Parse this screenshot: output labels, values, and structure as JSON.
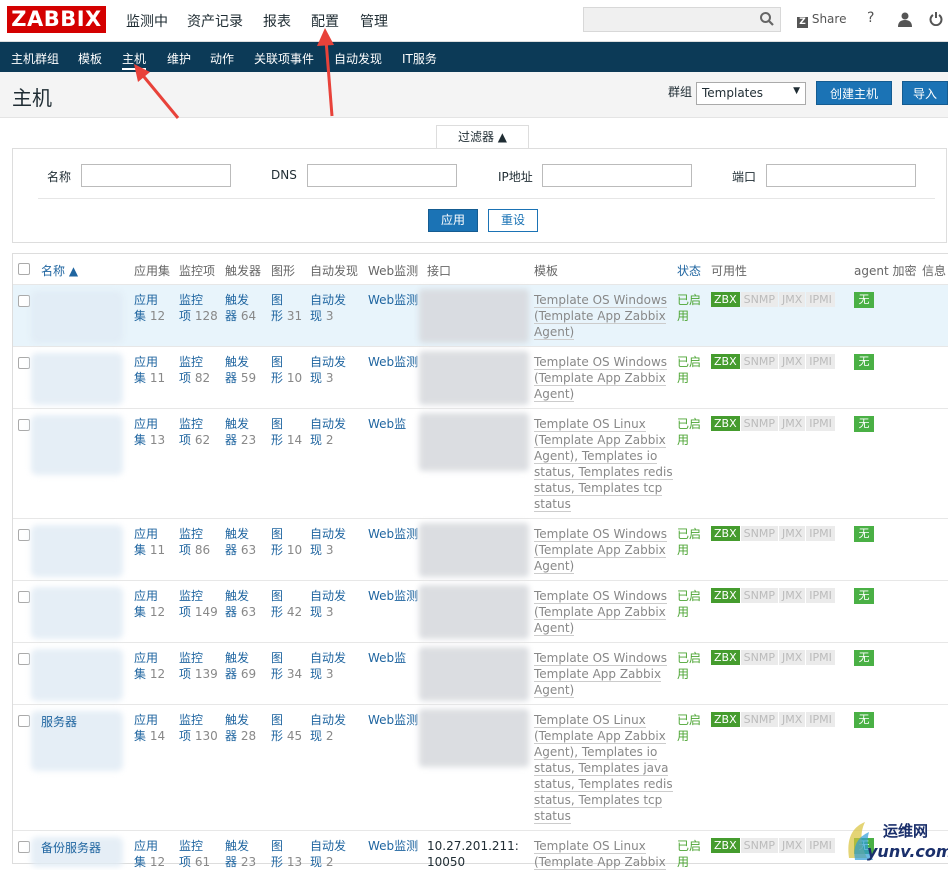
{
  "app": {
    "logo": "ZABBIX"
  },
  "topmenu": [
    "监测中",
    "资产记录",
    "报表",
    "配置",
    "管理"
  ],
  "toptools": {
    "share": "Share",
    "help": "?"
  },
  "navbar": [
    "主机群组",
    "模板",
    "主机",
    "维护",
    "动作",
    "关联项事件",
    "自动发现",
    "IT服务"
  ],
  "header": {
    "title": "主机",
    "group_label": "群组",
    "group_value": "Templates",
    "create_button": "创建主机",
    "import_button": "导入"
  },
  "filter": {
    "tab_label": "过滤器 ▲",
    "fields": [
      {
        "label": "名称",
        "value": ""
      },
      {
        "label": "DNS",
        "value": ""
      },
      {
        "label": "IP地址",
        "value": ""
      },
      {
        "label": "端口",
        "value": ""
      }
    ],
    "apply_button": "应用",
    "reset_button": "重设"
  },
  "table": {
    "columns": [
      "名称 ▲",
      "应用集",
      "监控项",
      "触发器",
      "图形",
      "自动发现",
      "Web监测",
      "接口",
      "模板",
      "状态",
      "可用性",
      "agent 加密",
      "信息"
    ],
    "availability_badges": [
      "ZBX",
      "SNMP",
      "JMX",
      "IPMI"
    ],
    "rows": [
      {
        "name": "",
        "apps_l": [
          "应用",
          "集"
        ],
        "apps_n": "12",
        "items_l": [
          "监控",
          "项"
        ],
        "items_n": "128",
        "trig_l": [
          "触发",
          "器"
        ],
        "trig_n": "64",
        "graph_l": [
          "图",
          "形"
        ],
        "graph_n": "31",
        "disc_l": [
          "自动发",
          "现"
        ],
        "disc_n": "3",
        "web": "Web监测",
        "iface": [
          "",
          ""
        ],
        "templates": [
          "Template OS Windows",
          "(Template App Zabbix",
          "Agent)"
        ],
        "status": [
          "已启",
          "用"
        ],
        "enc": "无"
      },
      {
        "name": "",
        "apps_l": [
          "应用",
          "集"
        ],
        "apps_n": "11",
        "items_l": [
          "监控",
          "项"
        ],
        "items_n": "82",
        "trig_l": [
          "触发",
          "器"
        ],
        "trig_n": "59",
        "graph_l": [
          "图",
          "形"
        ],
        "graph_n": "10",
        "disc_l": [
          "自动发",
          "现"
        ],
        "disc_n": "3",
        "web": "Web监测",
        "iface": [
          "",
          ""
        ],
        "templates": [
          "Template OS Windows",
          "(Template App Zabbix",
          "Agent)"
        ],
        "status": [
          "已启",
          "用"
        ],
        "enc": "无"
      },
      {
        "name": "",
        "apps_l": [
          "应用",
          "集"
        ],
        "apps_n": "13",
        "items_l": [
          "监控",
          "项"
        ],
        "items_n": "62",
        "trig_l": [
          "触发",
          "器"
        ],
        "trig_n": "23",
        "graph_l": [
          "图",
          "形"
        ],
        "graph_n": "14",
        "disc_l": [
          "自动发",
          "现"
        ],
        "disc_n": "2",
        "web": "Web监",
        "iface": [
          "",
          ""
        ],
        "templates": [
          "Template OS Linux",
          "(Template App Zabbix",
          "Agent), Templates io",
          "status, Templates redis",
          "status, Templates tcp",
          "status"
        ],
        "status": [
          "已启",
          "用"
        ],
        "enc": "无"
      },
      {
        "name": "",
        "apps_l": [
          "应用",
          "集"
        ],
        "apps_n": "11",
        "items_l": [
          "监控",
          "项"
        ],
        "items_n": "86",
        "trig_l": [
          "触发",
          "器"
        ],
        "trig_n": "63",
        "graph_l": [
          "图",
          "形"
        ],
        "graph_n": "10",
        "disc_l": [
          "自动发",
          "现"
        ],
        "disc_n": "3",
        "web": "Web监测",
        "iface": [
          "",
          ""
        ],
        "templates": [
          "Template OS Windows",
          "(Template App Zabbix",
          "Agent)"
        ],
        "status": [
          "已启",
          "用"
        ],
        "enc": "无"
      },
      {
        "name": "",
        "apps_l": [
          "应用",
          "集"
        ],
        "apps_n": "12",
        "items_l": [
          "监控",
          "项"
        ],
        "items_n": "149",
        "trig_l": [
          "触发",
          "器"
        ],
        "trig_n": "63",
        "graph_l": [
          "图",
          "形"
        ],
        "graph_n": "42",
        "disc_l": [
          "自动发",
          "现"
        ],
        "disc_n": "3",
        "web": "Web监测",
        "iface": [
          "",
          ""
        ],
        "templates": [
          "Template OS Windows",
          "(Template App Zabbix",
          "Agent)"
        ],
        "status": [
          "已启",
          "用"
        ],
        "enc": "无"
      },
      {
        "name": "",
        "apps_l": [
          "应用",
          "集"
        ],
        "apps_n": "12",
        "items_l": [
          "监控",
          "项"
        ],
        "items_n": "139",
        "trig_l": [
          "触发",
          "器"
        ],
        "trig_n": "69",
        "graph_l": [
          "图",
          "形"
        ],
        "graph_n": "34",
        "disc_l": [
          "自动发",
          "现"
        ],
        "disc_n": "3",
        "web": "Web监",
        "iface": [
          "",
          ""
        ],
        "templates": [
          "Template OS Windows",
          "Template App Zabbix",
          "Agent)"
        ],
        "status": [
          "已启",
          "用"
        ],
        "enc": "无"
      },
      {
        "name": "服务器",
        "apps_l": [
          "应用",
          "集"
        ],
        "apps_n": "14",
        "items_l": [
          "监控",
          "项"
        ],
        "items_n": "130",
        "trig_l": [
          "触发",
          "器"
        ],
        "trig_n": "28",
        "graph_l": [
          "图",
          "形"
        ],
        "graph_n": "45",
        "disc_l": [
          "自动发",
          "现"
        ],
        "disc_n": "2",
        "web": "Web监测",
        "iface": [
          "",
          ""
        ],
        "templates": [
          "Template OS Linux",
          "(Template App Zabbix",
          "Agent), Templates io",
          "status, Templates java",
          "status, Templates redis",
          "status, Templates tcp",
          "status"
        ],
        "status": [
          "已启",
          "用"
        ],
        "enc": "无"
      },
      {
        "name": "备份服务器",
        "apps_l": [
          "应用",
          "集"
        ],
        "apps_n": "12",
        "items_l": [
          "监控",
          "项"
        ],
        "items_n": "61",
        "trig_l": [
          "触发",
          "器"
        ],
        "trig_n": "23",
        "graph_l": [
          "图",
          "形"
        ],
        "graph_n": "13",
        "disc_l": [
          "自动发",
          "现"
        ],
        "disc_n": "2",
        "web": "Web监测",
        "iface": [
          "10.27.201.211:",
          "10050"
        ],
        "templates": [
          "Template OS Linux",
          "(Template App Zabbix"
        ],
        "status": [
          "已启",
          "用"
        ],
        "enc": "无"
      }
    ]
  },
  "watermark": {
    "brand": "运维网",
    "domain": "yunv.com"
  },
  "colors": {
    "logo_red": "#d40000",
    "nav_bg": "#0c3a57",
    "button_blue": "#1b73b5",
    "status_green": "#4da534",
    "arrow_red": "#e8423a"
  }
}
